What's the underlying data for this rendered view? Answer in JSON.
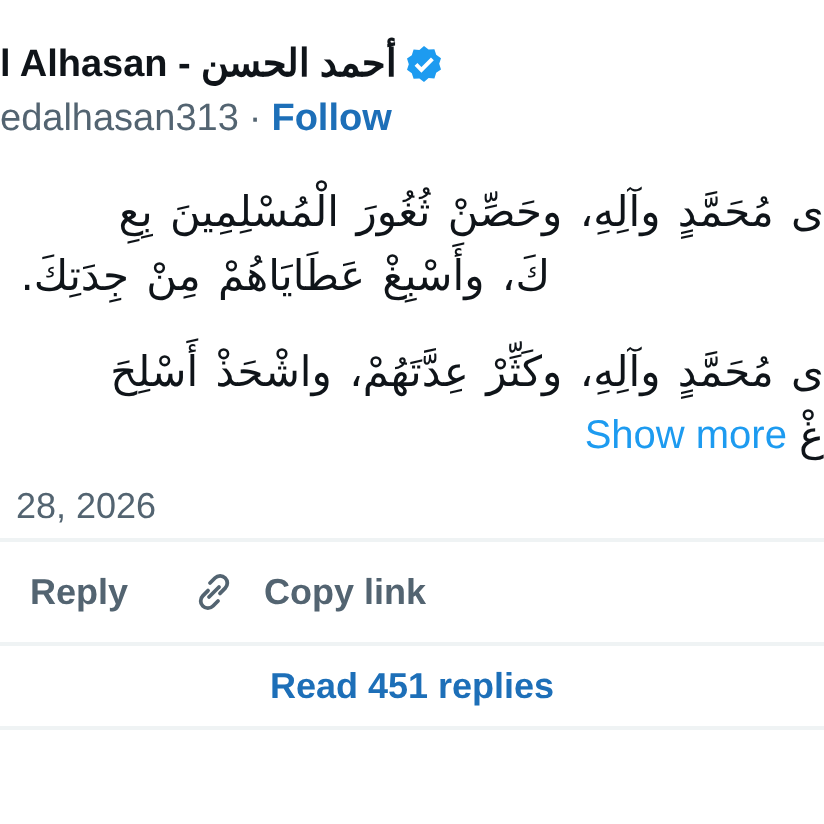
{
  "author": {
    "display_name": "l Alhasan - أحمد الحسن",
    "verified": true,
    "handle": "edalhasan313",
    "separator": "·",
    "follow": "Follow"
  },
  "paragraphs": [
    {
      "lines": [
        "ى مُحَمَّدٍ وآلِهِ، وحَصِّنْ ثُغُورَ الْمُسْلِمِينَ بِعِ",
        "كَ، وأَسْبِغْ عَطَايَاهُمْ مِنْ جِدَتِكَ."
      ]
    },
    {
      "lines": [
        "ى مُحَمَّدٍ وآلِهِ، وكَثِّرْ عِدَّتَهُمْ، واشْحَذْ أَسْلِحَ",
        "غْ"
      ],
      "show_more": "Show more"
    }
  ],
  "date": "28, 2026",
  "reply_action": {
    "label": "Reply"
  },
  "copy_link_action": {
    "label": "Copy link"
  },
  "read_replies": "Read 451 replies"
}
